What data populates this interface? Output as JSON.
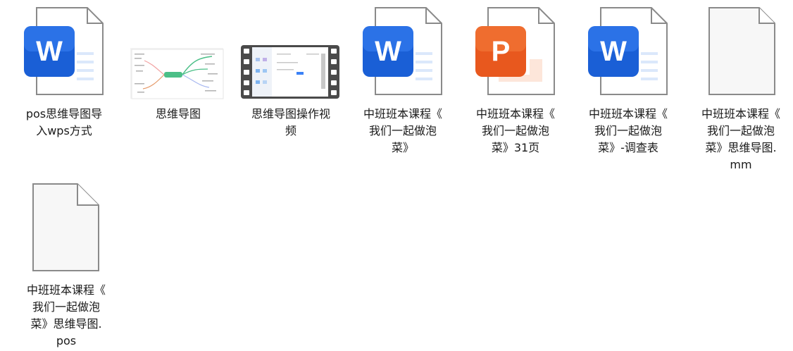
{
  "files": [
    {
      "label": "pos思维导图导\n入wps方式",
      "icon": "word-doc-icon"
    },
    {
      "label": "思维导图",
      "icon": "mindmap-image-thumbnail"
    },
    {
      "label": "思维导图操作视\n频",
      "icon": "video-file-thumbnail"
    },
    {
      "label": "中班班本课程《\n我们一起做泡\n菜》",
      "icon": "word-doc-icon"
    },
    {
      "label": "中班班本课程《\n我们一起做泡\n菜》31页",
      "icon": "powerpoint-doc-icon"
    },
    {
      "label": "中班班本课程《\n我们一起做泡\n菜》-调查表",
      "icon": "word-doc-icon"
    },
    {
      "label": "中班班本课程《\n我们一起做泡\n菜》思维导图.\nmm",
      "icon": "blank-file-icon"
    },
    {
      "label": "中班班本课程《\n我们一起做泡\n菜》思维导图.\npos",
      "icon": "blank-file-icon"
    }
  ],
  "colors": {
    "word_blue": "#1a5fd6",
    "word_blue_light": "#3b82f6",
    "ppt_orange": "#e8581e",
    "ppt_orange_light": "#f47b3a",
    "page_border": "#8a8a8a",
    "page_fill": "#ffffff",
    "blank_fill": "#f7f7f7"
  }
}
